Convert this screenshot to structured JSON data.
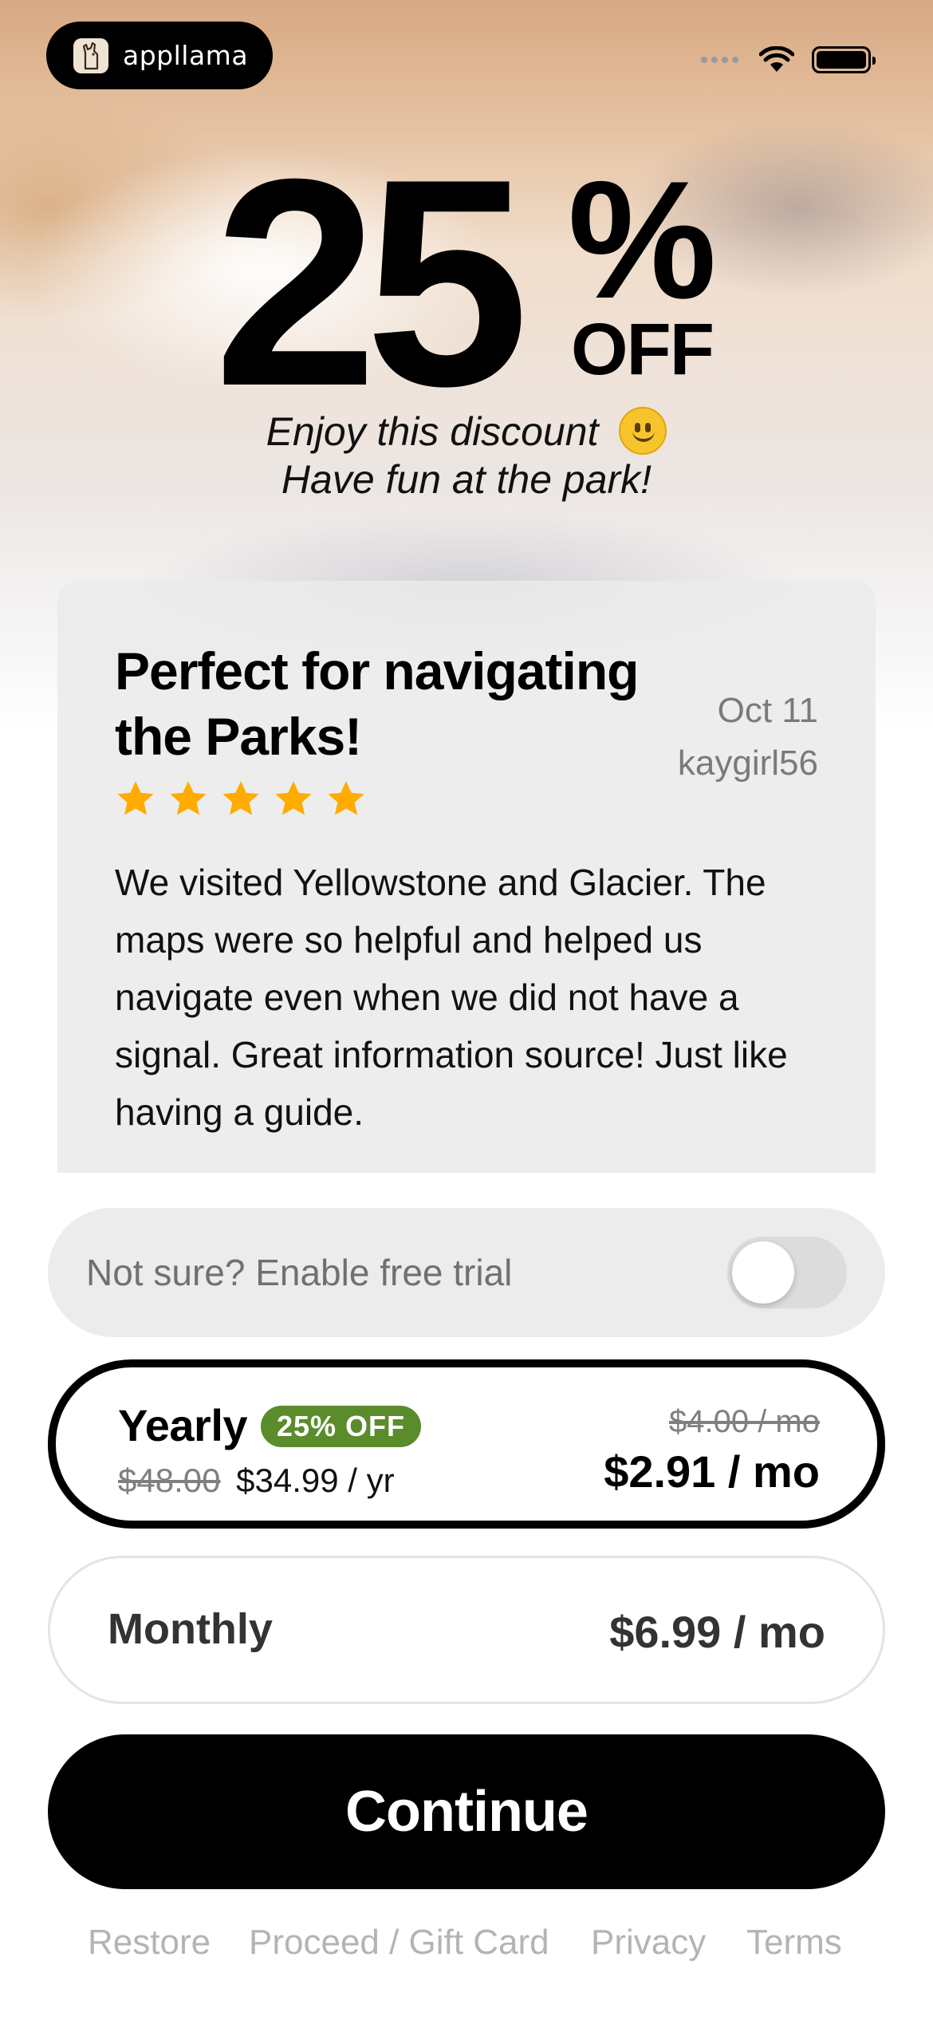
{
  "status_bar": {
    "brand_name": "appllama",
    "logo_icon": "llama-icon"
  },
  "hero": {
    "discount_number": "25",
    "percent_sign": "%",
    "off_label": "OFF",
    "tagline_1": "Enjoy this discount",
    "tagline_2": "Have fun at the park!"
  },
  "review": {
    "title": "Perfect for navigating the Parks!",
    "date": "Oct 11",
    "author": "kaygirl56",
    "rating": 5,
    "star_color": "#ffab00",
    "body": "We visited Yellowstone and Glacier. The maps were so helpful and helped us navigate even when we did not have a signal. Great information source! Just like having a guide."
  },
  "trial": {
    "label": "Not sure? Enable free trial",
    "enabled": false
  },
  "plans": {
    "yearly": {
      "name": "Yearly",
      "badge": "25% OFF",
      "badge_color": "#5b8c2b",
      "old_price": "$48.00",
      "price": "$34.99 / yr",
      "old_monthly": "$4.00 / mo",
      "monthly_equivalent": "$2.91 / mo",
      "selected": true
    },
    "monthly": {
      "name": "Monthly",
      "price": "$6.99 / mo",
      "selected": false
    }
  },
  "cta": {
    "continue_label": "Continue"
  },
  "footer": {
    "restore": "Restore",
    "gift_card": "Proceed / Gift Card",
    "privacy": "Privacy",
    "terms": "Terms"
  }
}
